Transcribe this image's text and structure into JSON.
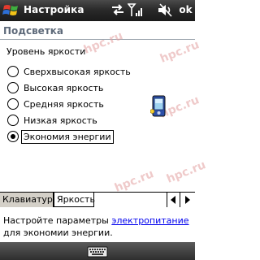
{
  "titlebar": {
    "title": "Настройка",
    "ok_label": "ok",
    "icons": [
      "windows-start-icon",
      "connectivity-arrows-icon",
      "signal-strength-icon",
      "volume-icon"
    ]
  },
  "section": {
    "title": "Подсветка"
  },
  "brightness": {
    "group_label": "Уровень яркости",
    "options": [
      {
        "label": "Сверхвысокая яркость",
        "checked": false
      },
      {
        "label": "Высокая яркость",
        "checked": false
      },
      {
        "label": "Средняя яркость",
        "checked": false
      },
      {
        "label": "Низкая яркость",
        "checked": false
      },
      {
        "label": "Экономия энергии",
        "checked": true
      }
    ],
    "device_icon": "pda-device-icon"
  },
  "watermark": {
    "text": "hpc.ru"
  },
  "tabs": {
    "items": [
      {
        "label": "Клавиатур",
        "active": false
      },
      {
        "label": "Яркость",
        "active": true
      }
    ],
    "scroll_left_icon": "arrow-left-icon",
    "scroll_right_icon": "arrow-right-icon"
  },
  "footer_text": {
    "prefix": "Настройте параметры",
    "link": "электропитание",
    "suffix": "для экономии энергии."
  },
  "menubar": {
    "icon": "keyboard-icon"
  },
  "colors": {
    "titlebar": "#2a2a2a",
    "section_title": "#5e6a7a",
    "link": "#0000ee",
    "watermark": "#e3a0a0"
  }
}
